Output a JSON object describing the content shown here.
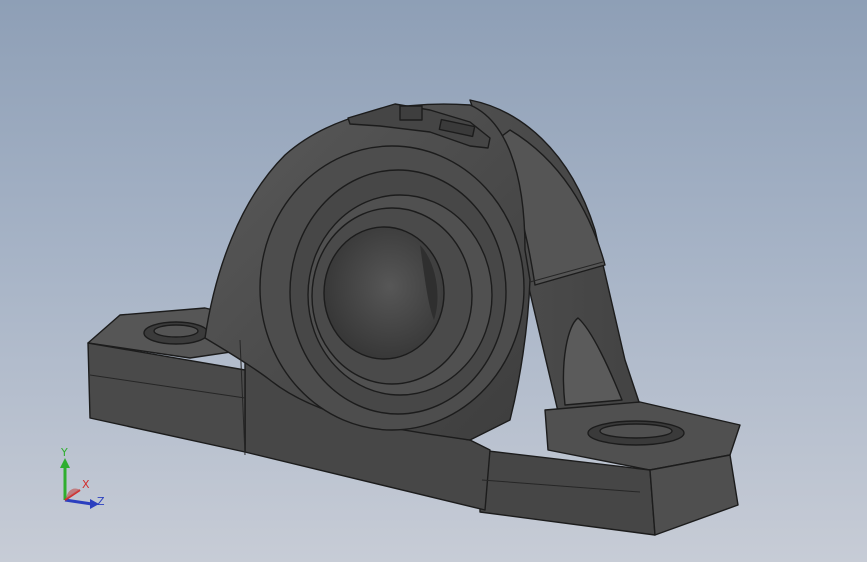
{
  "viewport": {
    "background_top": "#8e9fb6",
    "background_bottom": "#c7ccd6"
  },
  "model": {
    "name": "pillow-block-bearing",
    "body_color": "#4b4b4b",
    "edge_color": "#1c1c1c"
  },
  "triad": {
    "y_label": "Y",
    "x_label": "X",
    "z_label": "Z",
    "y_color": "#2fae2f",
    "x_color": "#d22d2d",
    "z_color": "#2b3fbf"
  }
}
